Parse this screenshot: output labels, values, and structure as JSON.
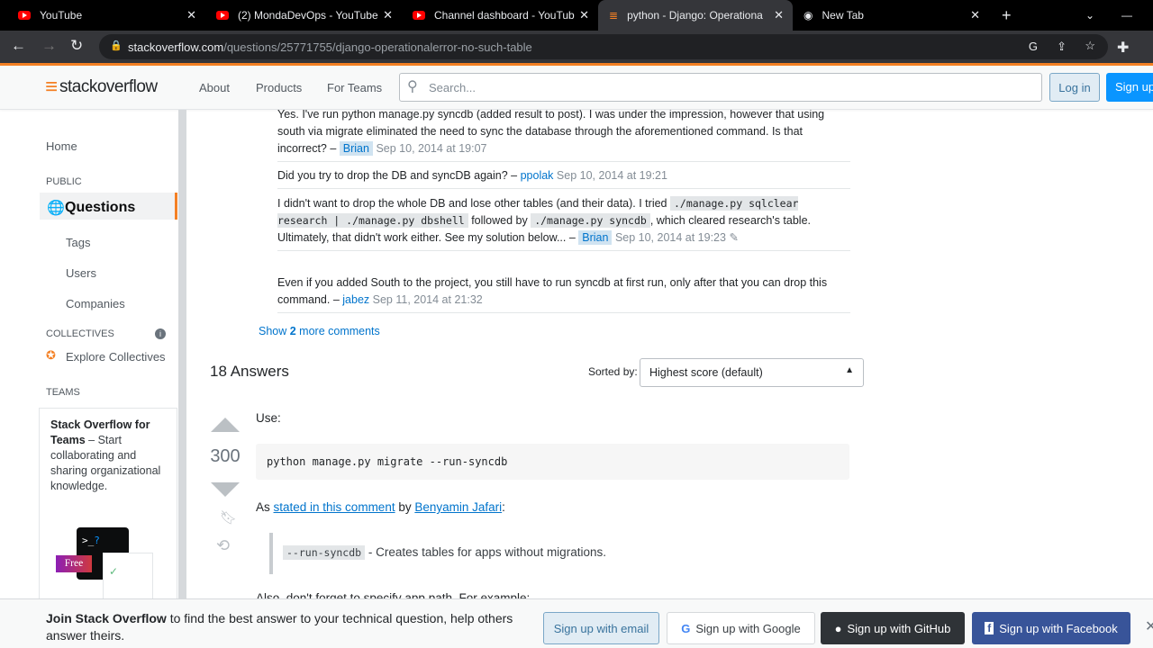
{
  "browser": {
    "tabs": [
      {
        "title": "YouTube"
      },
      {
        "title": "(2) MondaDevOps - YouTube"
      },
      {
        "title": "Channel dashboard - YouTub"
      },
      {
        "title": "python - Django: Operationa"
      },
      {
        "title": "New Tab"
      }
    ],
    "url_host": "stackoverflow.com",
    "url_path": "/questions/25771755/django-operationalerror-no-such-table"
  },
  "header": {
    "logo": "stackoverflow",
    "nav": [
      "About",
      "Products",
      "For Teams"
    ],
    "search_placeholder": "Search...",
    "login": "Log in",
    "signup": "Sign up"
  },
  "sidebar": {
    "home": "Home",
    "public": "PUBLIC",
    "questions": "Questions",
    "tags": "Tags",
    "users": "Users",
    "companies": "Companies",
    "collectives": "COLLECTIVES",
    "explore": "Explore Collectives",
    "teams": "TEAMS",
    "teams_title": "Stack Overflow for Teams",
    "teams_text": " – Start collaborating and sharing organizational knowledge.",
    "free": "Free"
  },
  "comments": [
    {
      "text": "Yes. I've run python manage.py syncdb (added result to post). I was under the impression, however that using south via migrate eliminated the need to sync the database through the aforementioned command. Is that incorrect? – ",
      "user": "Brian",
      "date": "Sep 10, 2014 at 19:07"
    },
    {
      "text": "Did you try to drop the DB and syncDB again? – ",
      "user": "ppolak",
      "date": "Sep 10, 2014 at 19:21"
    },
    {
      "t1": "I didn't want to drop the whole DB and lose other tables (and their data). I tried ",
      "c1": "./manage.py sqlclear research | ./manage.py dbshell",
      "t2": " followed by ",
      "c2": "./manage.py syncdb",
      "t3": ", which cleared research's table. Ultimately, that didn't work either. See my solution below... – ",
      "user": "Brian",
      "date": "Sep 10, 2014 at 19:23"
    },
    {
      "text": "Even if you added South to the project, you still have to run syncdb at first run, only after that you can drop this command. – ",
      "user": "jabez",
      "date": "Sep 11, 2014 at 21:32"
    }
  ],
  "show_more": {
    "pre": "Show ",
    "count": "2",
    "post": " more comments"
  },
  "answers": {
    "count_label": "18 Answers",
    "sorted_by": "Sorted by:",
    "sort_value": "Highest score (default)"
  },
  "answer": {
    "score": "300",
    "use": "Use:",
    "code": "python manage.py migrate --run-syncdb",
    "as": "As ",
    "link1": "stated in this comment",
    "by": " by ",
    "link2": "Benyamin Jafari",
    "colon": ":",
    "quote_code": "--run-syncdb",
    "quote_text": " - Creates tables for apps without migrations.",
    "cut": "Also, don't forget to specify app path. For example:"
  },
  "footer": {
    "join": "Join Stack Overflow",
    "text": " to find the best answer to your technical question, help others answer theirs.",
    "email": "Sign up with email",
    "google": "Sign up with Google",
    "github": "Sign up with GitHub",
    "facebook": "Sign up with Facebook"
  },
  "colors": {
    "accent": "#f48024",
    "link": "#0074cc",
    "signup": "#0a95ff",
    "github": "#2f3337",
    "facebook": "#385499"
  }
}
